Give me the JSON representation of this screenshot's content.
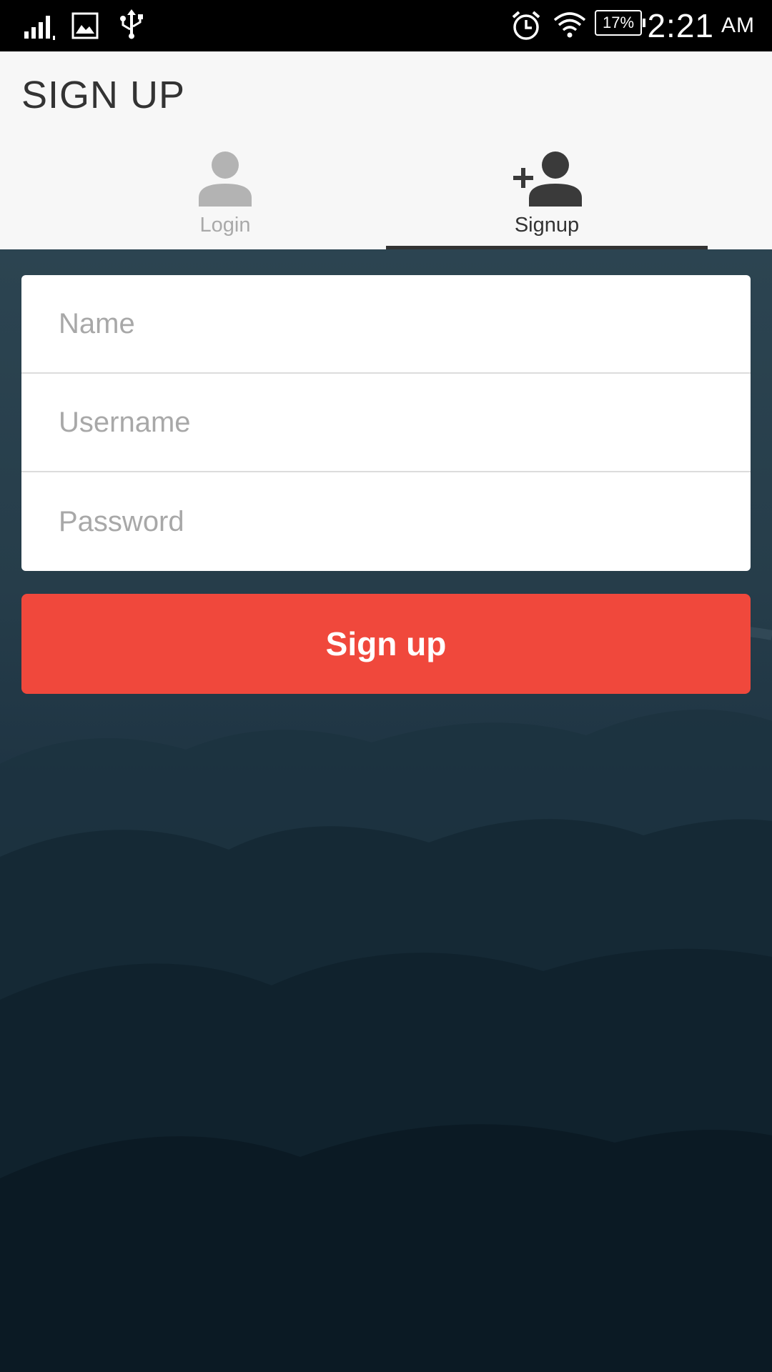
{
  "status_bar": {
    "time": "2:21",
    "ampm": "AM",
    "battery": "17%",
    "icons": [
      "signal-icon",
      "image-notification-icon",
      "usb-icon",
      "alarm-icon",
      "wifi-icon",
      "battery-icon"
    ]
  },
  "header": {
    "title": "SIGN UP"
  },
  "tabs": [
    {
      "label": "Login",
      "icon": "person-icon",
      "active": false
    },
    {
      "label": "Signup",
      "icon": "person-add-icon",
      "active": true
    }
  ],
  "form": {
    "name_placeholder": "Name",
    "username_placeholder": "Username",
    "password_placeholder": "Password",
    "submit_label": "Sign up"
  },
  "colors": {
    "accent": "#f0483c",
    "header_bg": "#f7f7f7",
    "active_tab_text": "#333333",
    "inactive_tab_text": "#a9a9a9",
    "backdrop": "#1b3040"
  }
}
